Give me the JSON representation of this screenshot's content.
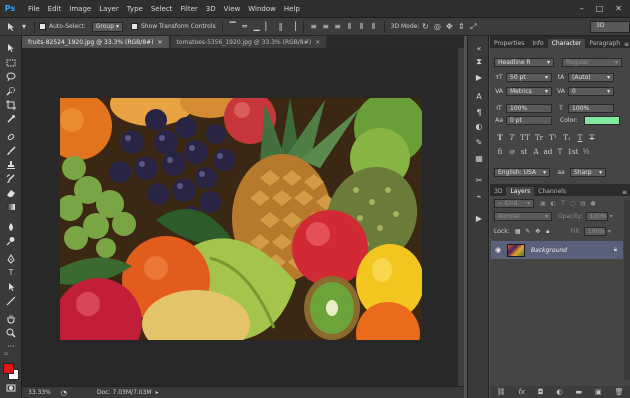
{
  "app": {
    "logo": "Ps"
  },
  "menu": [
    "File",
    "Edit",
    "Image",
    "Layer",
    "Type",
    "Select",
    "Filter",
    "3D",
    "View",
    "Window",
    "Help"
  ],
  "window_controls": [
    "–",
    "□",
    "✕"
  ],
  "options": {
    "auto_select_label": "Auto-Select:",
    "auto_select_value": "Group",
    "transform_label": "Show Transform Controls",
    "mode_3d_label": "3D Mode:",
    "workspace": "3D"
  },
  "documents": {
    "tabs": [
      {
        "label": "fruits-82524_1920.jpg @ 33.3% (RGB/8#)",
        "close": "×",
        "active": true
      },
      {
        "label": "tomatoes-5356_1920.jpg @ 33.3% (RGB/8#)",
        "close": "×",
        "active": false
      }
    ]
  },
  "status": {
    "zoom": "33.33%",
    "doc_info": "Doc: 7.03M/7.03M"
  },
  "character_panel": {
    "tabs": [
      "Properties",
      "Info",
      "Character",
      "Paragraph"
    ],
    "active_tab": "Character",
    "font_family": "Headline R",
    "font_style": "Regular",
    "font_size": "50 pt",
    "leading": "(Auto)",
    "kerning": "Metrics",
    "tracking": "0",
    "vertical_scale": "100%",
    "horizontal_scale": "100%",
    "baseline_shift": "0 pt",
    "color_label": "Color:",
    "color_swatch": "#7ee89e",
    "format_buttons": [
      "T",
      "T",
      "TT",
      "Tr",
      "T¹",
      "T₁",
      "T",
      "T"
    ],
    "opentype_buttons": [
      "fi",
      "ơ",
      "st",
      "A",
      "ad",
      "T",
      "1st",
      "½"
    ],
    "language": "English: USA",
    "aa_label": "aa",
    "antialias": "Sharp"
  },
  "layers_panel": {
    "tabs": [
      "3D",
      "Layers",
      "Channels"
    ],
    "active_tab": "Layers",
    "filter": "Kind",
    "blend_mode": "Normal",
    "opacity_label": "Opacity:",
    "opacity": "100%",
    "lock_label": "Lock:",
    "fill_label": "Fill:",
    "fill": "100%",
    "layer_name": "Background"
  }
}
